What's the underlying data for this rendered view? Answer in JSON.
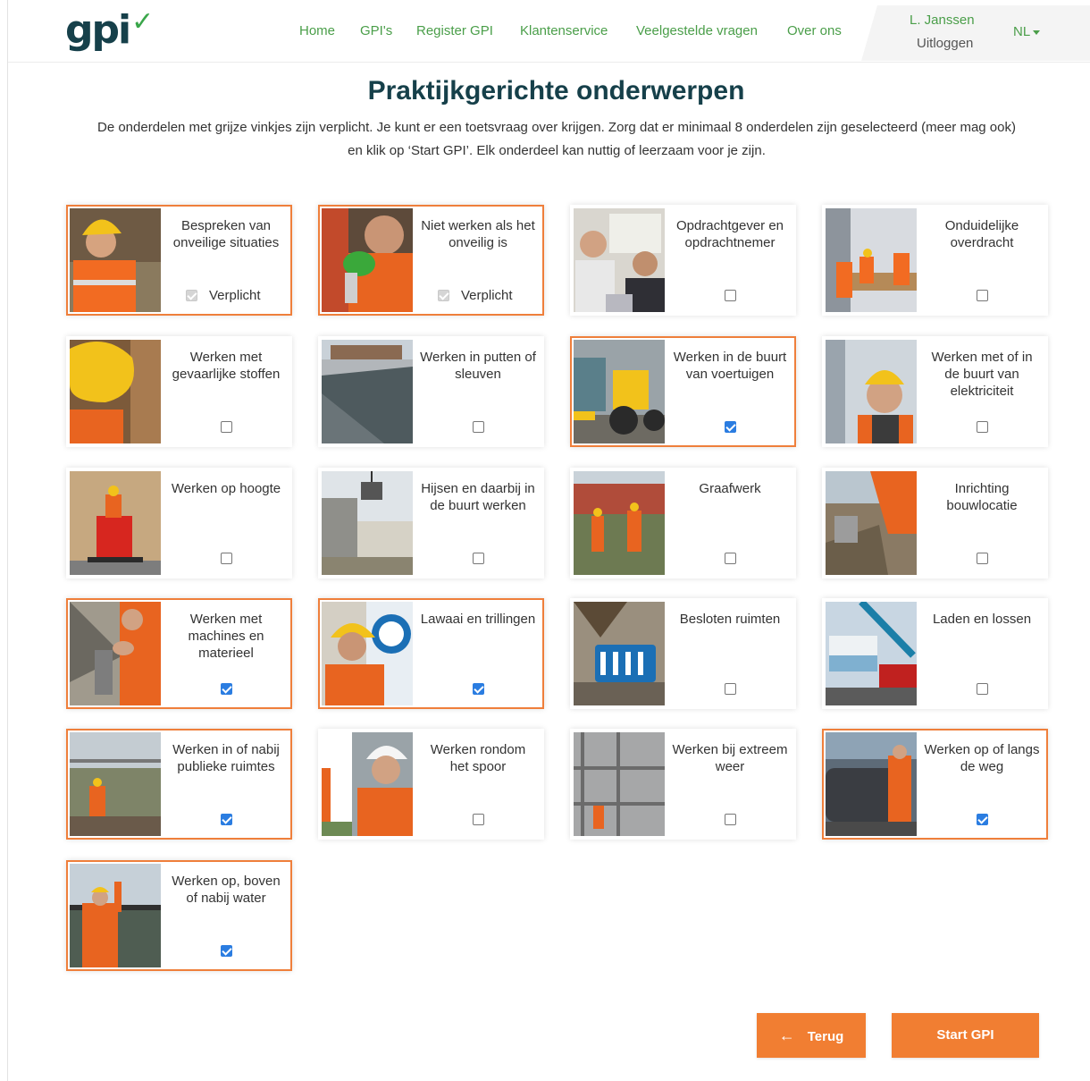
{
  "header": {
    "logo": "gpi",
    "nav": [
      {
        "label": "Home"
      },
      {
        "label": "GPI's"
      },
      {
        "label": "Register GPI"
      },
      {
        "label": "Klantenservice"
      },
      {
        "label": "Veelgestelde vragen"
      },
      {
        "label": "Over ons"
      }
    ],
    "user_name": "L. Janssen",
    "logout_label": "Uitloggen",
    "language": "NL"
  },
  "page": {
    "title": "Praktijkgerichte onderwerpen",
    "intro_line1": "De onderdelen met grijze vinkjes zijn verplicht. Je kunt er een toetsvraag over krijgen. Zorg dat er minimaal 8 onderdelen zijn geselecteerd (meer mag ook)",
    "intro_line2": "en klik op ‘Start GPI’. Elk onderdeel kan nuttig of leerzaam voor je zijn."
  },
  "topics": [
    {
      "label": "Bespreken van onveilige situaties",
      "status": "required",
      "status_label": "Verplicht",
      "selected": true
    },
    {
      "label": "Niet werken als het onveilig is",
      "status": "required",
      "status_label": "Verplicht",
      "selected": true
    },
    {
      "label": "Opdrachtgever en opdrachtnemer",
      "status": "unchecked",
      "selected": false
    },
    {
      "label": "Onduidelijke overdracht",
      "status": "unchecked",
      "selected": false
    },
    {
      "label": "Werken met gevaarlijke stoffen",
      "status": "unchecked",
      "selected": false
    },
    {
      "label": "Werken in putten of sleuven",
      "status": "unchecked",
      "selected": false
    },
    {
      "label": "Werken in de buurt van voertuigen",
      "status": "checked",
      "selected": true
    },
    {
      "label": "Werken met of in de buurt van elektriciteit",
      "status": "unchecked",
      "selected": false
    },
    {
      "label": "Werken op hoogte",
      "status": "unchecked",
      "selected": false
    },
    {
      "label": "Hijsen en daarbij in de buurt werken",
      "status": "unchecked",
      "selected": false
    },
    {
      "label": "Graafwerk",
      "status": "unchecked",
      "selected": false
    },
    {
      "label": "Inrichting bouwlocatie",
      "status": "unchecked",
      "selected": false
    },
    {
      "label": "Werken met machines en materieel",
      "status": "checked",
      "selected": true
    },
    {
      "label": "Lawaai en trillingen",
      "status": "checked",
      "selected": true
    },
    {
      "label": "Besloten ruimten",
      "status": "unchecked",
      "selected": false
    },
    {
      "label": "Laden en lossen",
      "status": "unchecked",
      "selected": false
    },
    {
      "label": "Werken in of nabij publieke ruimtes",
      "status": "checked",
      "selected": true
    },
    {
      "label": "Werken rondom het spoor",
      "status": "unchecked",
      "selected": false
    },
    {
      "label": "Werken bij extreem weer",
      "status": "unchecked",
      "selected": false
    },
    {
      "label": "Werken op of langs de weg",
      "status": "checked",
      "selected": true
    },
    {
      "label": "Werken op, boven of nabij water",
      "status": "checked",
      "selected": true
    }
  ],
  "buttons": {
    "back_label": "Terug",
    "start_label": "Start GPI"
  },
  "colors": {
    "accent_orange": "#f17e32",
    "selected_border": "#ef7f3b",
    "nav_green": "#4a9e49",
    "title_navy": "#16404a",
    "checkbox_blue": "#2b7de1"
  }
}
